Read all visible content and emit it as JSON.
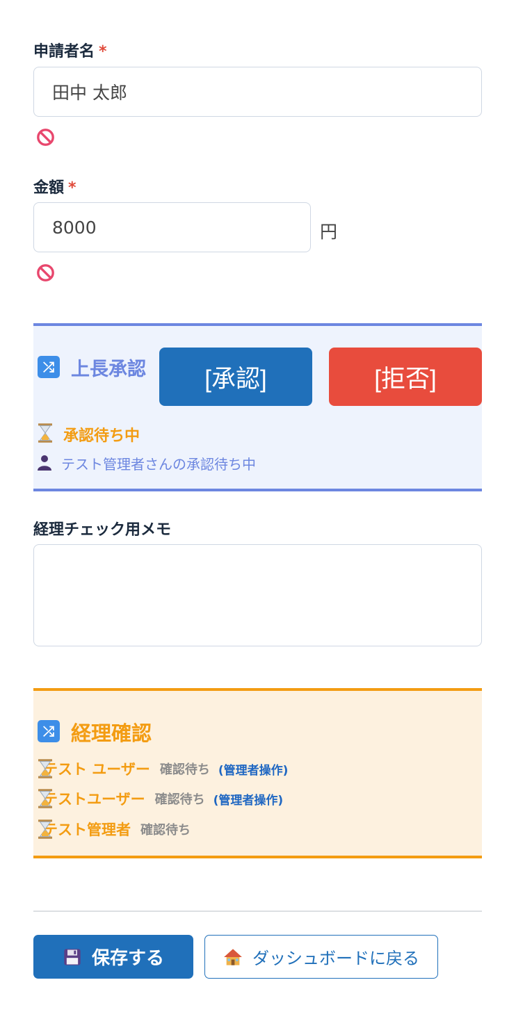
{
  "applicant": {
    "label": "申請者名",
    "required_mark": "*",
    "value": "田中 太郎"
  },
  "amount": {
    "label": "金額",
    "required_mark": "*",
    "value": "8000",
    "unit": "円"
  },
  "manager_approval": {
    "title": "上長承認",
    "approve_label": "[承認]",
    "reject_label": "[拒否]",
    "status": "承認待ち中",
    "waiting_text": "テスト管理者さんの承認待ち中"
  },
  "memo": {
    "label": "経理チェック用メモ",
    "value": ""
  },
  "accounting_check": {
    "title": "経理確認",
    "rows": [
      {
        "name": "テスト ユーザー",
        "status": "確認待ち",
        "admin": "(管理者操作)"
      },
      {
        "name": "テストユーザー",
        "status": "確認待ち",
        "admin": "(管理者操作)"
      },
      {
        "name": "テスト管理者",
        "status": "確認待ち"
      }
    ]
  },
  "footer": {
    "save_label": "保存する",
    "back_label": "ダッシュボードに戻る"
  },
  "icons": {
    "section": "shuffle-icon",
    "error": "ban-icon",
    "pending": "hourglass-icon",
    "user": "person-icon",
    "save": "floppy-disk-icon",
    "back": "house-icon"
  },
  "colors": {
    "primary": "#2070ba",
    "danger": "#e84c3d",
    "manager_accent": "#6c86e0",
    "accounting_accent": "#f39c12",
    "error_icon": "#e8476d"
  }
}
